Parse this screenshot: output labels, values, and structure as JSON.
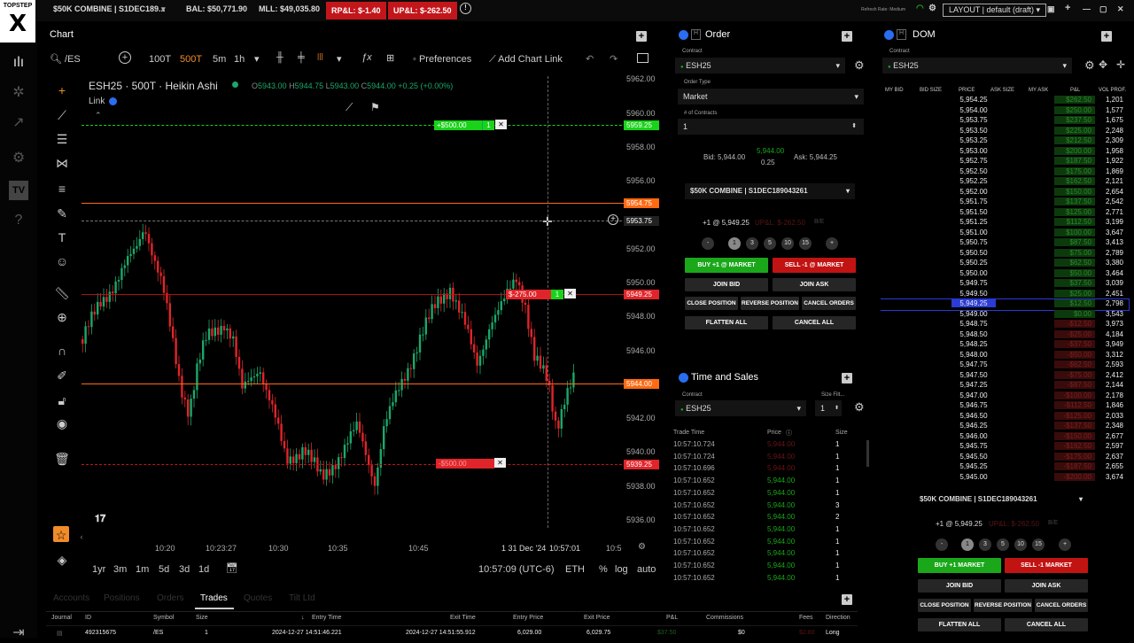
{
  "topbar": {
    "account": "$50K COMBINE  |  S1DEC189...",
    "bal": "BAL: $50,771.90",
    "mll": "MLL: $49,035.80",
    "rpnl": "RP&L: $-1.40",
    "upnl": "UP&L: $-262.50",
    "refresh": "Refresh Rate: Medium",
    "layout": "LAYOUT | default (draft)"
  },
  "logo": {
    "brand": "TOPSTEP",
    "mark": "X"
  },
  "chart": {
    "panel_title": "Chart",
    "symbol_search": "/ES",
    "intervals": [
      "100T",
      "500T",
      "5m",
      "1h"
    ],
    "active_interval": "500T",
    "preferences": "Preferences",
    "add_chart_link": "Add Chart Link",
    "legend_title": "ESH25 · 500T · Heikin Ashi",
    "ohlc": {
      "o": "5943.00",
      "h": "5944.75",
      "l": "5943.00",
      "c": "5944.00",
      "chg": "+0.25 (+0.00%)"
    },
    "link_label": "Link",
    "y_ticks": [
      "5962.00",
      "5960.00",
      "5958.00",
      "5956.00",
      "5952.00",
      "5950.00",
      "5948.00",
      "5946.00",
      "5942.00",
      "5940.00",
      "5938.00",
      "5936.00"
    ],
    "x_ticks": [
      "10:20",
      "10:23:27",
      "10:30",
      "10:35",
      "10:45",
      "31 Dec '24",
      "10:57:01",
      "10:5"
    ],
    "price_tags": {
      "tp": "5959.25",
      "tp_pnl": "+$500.00",
      "tp_qty": "1",
      "orange_top": "5954.75",
      "crosshair": "5953.75",
      "position": "5949.25",
      "position_pnl": "$-275.00",
      "position_qty": "1",
      "last": "5944.00",
      "sl": "5939.25",
      "sl_pnl": "-$500.00"
    },
    "ranges": [
      "1yr",
      "3m",
      "1m",
      "5d",
      "3d",
      "1d"
    ],
    "clock": "10:57:09 (UTC-6)",
    "session": "ETH",
    "scale_opts": [
      "%",
      "log",
      "auto"
    ],
    "colors": {
      "up": "#1aa86a",
      "down": "#e0242a",
      "orange": "#ff6a13",
      "tp_green": "#19d219"
    }
  },
  "order": {
    "title": "Order",
    "contract_label": "Contract",
    "contract": "ESH25",
    "order_type_label": "Order Type",
    "order_type": "Market",
    "contracts_label": "# of Contracts",
    "contracts": "1",
    "bid": "Bid: 5,944.00",
    "ask": "Ask: 5,944.25",
    "last": "5,944.00",
    "spread": "0.25",
    "account": "$50K COMBINE  |  S1DEC189043261",
    "position": "+1 @ 5,949.25",
    "position_pnl": "UP&L: $-262.50",
    "be": "B/E",
    "qtys": [
      "-",
      "1",
      "3",
      "5",
      "10",
      "15",
      "+"
    ],
    "buy": "BUY +1 @ MARKET",
    "sell": "SELL -1 @ MARKET",
    "join_bid": "JOIN BID",
    "join_ask": "JOIN ASK",
    "close_position": "CLOSE POSITION",
    "reverse_position": "REVERSE POSITION",
    "cancel_orders": "CANCEL ORDERS",
    "flatten_all": "FLATTEN ALL",
    "cancel_all": "CANCEL ALL"
  },
  "time_sales": {
    "title": "Time and Sales",
    "contract_label": "Contract",
    "contract": "ESH25",
    "size_filter_label": "Size Filt...",
    "size_filter": "1",
    "headers": [
      "Trade Time",
      "Price",
      "Size"
    ],
    "rows": [
      {
        "t": "10:57:10.724",
        "p": "5,944.00",
        "s": "1",
        "side": "sell"
      },
      {
        "t": "10:57:10.724",
        "p": "5,944.00",
        "s": "1",
        "side": "sell"
      },
      {
        "t": "10:57:10.696",
        "p": "5,944.00",
        "s": "1",
        "side": "sell"
      },
      {
        "t": "10:57:10.652",
        "p": "5,944.00",
        "s": "1",
        "side": "buy"
      },
      {
        "t": "10:57:10.652",
        "p": "5,944.00",
        "s": "1",
        "side": "buy"
      },
      {
        "t": "10:57:10.652",
        "p": "5,944.00",
        "s": "3",
        "side": "buy"
      },
      {
        "t": "10:57:10.652",
        "p": "5,944.00",
        "s": "2",
        "side": "buy"
      },
      {
        "t": "10:57:10.652",
        "p": "5,944.00",
        "s": "1",
        "side": "buy"
      },
      {
        "t": "10:57:10.652",
        "p": "5,944.00",
        "s": "1",
        "side": "buy"
      },
      {
        "t": "10:57:10.652",
        "p": "5,944.00",
        "s": "1",
        "side": "buy"
      },
      {
        "t": "10:57:10.652",
        "p": "5,944.00",
        "s": "1",
        "side": "buy"
      },
      {
        "t": "10:57:10.652",
        "p": "5,944.00",
        "s": "1",
        "side": "buy"
      }
    ]
  },
  "dom": {
    "title": "DOM",
    "contract_label": "Contract",
    "contract": "ESH25",
    "headers": [
      "MY BID",
      "BID SIZE",
      "PRICE",
      "ASK SIZE",
      "MY ASK",
      "P&L",
      "VOL PROF."
    ],
    "rows": [
      {
        "p": "5,954.25",
        "pnl": "$262.50",
        "v": "1,201"
      },
      {
        "p": "5,954.00",
        "pnl": "$250.00",
        "v": "1,577"
      },
      {
        "p": "5,953.75",
        "pnl": "$237.50",
        "v": "1,675"
      },
      {
        "p": "5,953.50",
        "pnl": "$225.00",
        "v": "2,248"
      },
      {
        "p": "5,953.25",
        "pnl": "$212.50",
        "v": "2,309"
      },
      {
        "p": "5,953.00",
        "pnl": "$200.00",
        "v": "1,958"
      },
      {
        "p": "5,952.75",
        "pnl": "$187.50",
        "v": "1,922"
      },
      {
        "p": "5,952.50",
        "pnl": "$175.00",
        "v": "1,869"
      },
      {
        "p": "5,952.25",
        "pnl": "$162.50",
        "v": "2,121"
      },
      {
        "p": "5,952.00",
        "pnl": "$150.00",
        "v": "2,654"
      },
      {
        "p": "5,951.75",
        "pnl": "$137.50",
        "v": "2,542"
      },
      {
        "p": "5,951.50",
        "pnl": "$125.00",
        "v": "2,771"
      },
      {
        "p": "5,951.25",
        "pnl": "$112.50",
        "v": "3,199"
      },
      {
        "p": "5,951.00",
        "pnl": "$100.00",
        "v": "3,647"
      },
      {
        "p": "5,950.75",
        "pnl": "$87.50",
        "v": "3,413"
      },
      {
        "p": "5,950.50",
        "pnl": "$75.00",
        "v": "2,789"
      },
      {
        "p": "5,950.25",
        "pnl": "$62.50",
        "v": "3,380"
      },
      {
        "p": "5,950.00",
        "pnl": "$50.00",
        "v": "3,464"
      },
      {
        "p": "5,949.75",
        "pnl": "$37.50",
        "v": "3,039"
      },
      {
        "p": "5,949.50",
        "pnl": "$25.00",
        "v": "2,451"
      },
      {
        "p": "5,949.25",
        "pnl": "$12.50",
        "v": "2,798",
        "current": true
      },
      {
        "p": "5,949.00",
        "pnl": "$0.00",
        "v": "3,543"
      },
      {
        "p": "5,948.75",
        "pnl": "-$12.50",
        "v": "3,973"
      },
      {
        "p": "5,948.50",
        "pnl": "-$25.00",
        "v": "4,184"
      },
      {
        "p": "5,948.25",
        "pnl": "-$37.50",
        "v": "3,949"
      },
      {
        "p": "5,948.00",
        "pnl": "-$50.00",
        "v": "3,312"
      },
      {
        "p": "5,947.75",
        "pnl": "-$62.50",
        "v": "2,593"
      },
      {
        "p": "5,947.50",
        "pnl": "-$75.00",
        "v": "2,412"
      },
      {
        "p": "5,947.25",
        "pnl": "-$87.50",
        "v": "2,144"
      },
      {
        "p": "5,947.00",
        "pnl": "-$100.00",
        "v": "2,178"
      },
      {
        "p": "5,946.75",
        "pnl": "-$112.50",
        "v": "1,846"
      },
      {
        "p": "5,946.50",
        "pnl": "-$125.00",
        "v": "2,033"
      },
      {
        "p": "5,946.25",
        "pnl": "-$137.50",
        "v": "2,348"
      },
      {
        "p": "5,946.00",
        "pnl": "-$150.00",
        "v": "2,677"
      },
      {
        "p": "5,945.75",
        "pnl": "-$162.50",
        "v": "2,597"
      },
      {
        "p": "5,945.50",
        "pnl": "-$175.00",
        "v": "2,637"
      },
      {
        "p": "5,945.25",
        "pnl": "-$187.50",
        "v": "2,655"
      },
      {
        "p": "5,945.00",
        "pnl": "-$200.00",
        "v": "3,674"
      }
    ],
    "account": "$50K COMBINE  |  S1DEC189043261",
    "position": "+1 @ 5,949.25",
    "position_pnl": "UP&L: $-262.50",
    "be": "B/E",
    "qtys": [
      "-",
      "1",
      "3",
      "5",
      "10",
      "15",
      "+"
    ],
    "buy": "BUY +1 MARKET",
    "sell": "SELL -1 MARKET",
    "join_bid": "JOIN BID",
    "join_ask": "JOIN ASK",
    "close_position": "CLOSE POSITION",
    "reverse_position": "REVERSE POSITION",
    "cancel_orders": "CANCEL ORDERS",
    "flatten_all": "FLATTEN ALL",
    "cancel_all": "CANCEL ALL"
  },
  "bottom": {
    "tabs": [
      "Accounts",
      "Positions",
      "Orders",
      "Trades",
      "Quotes",
      "Tilt Ltd"
    ],
    "active_tab": "Trades",
    "headers": [
      "Journal",
      "ID",
      "Symbol",
      "Size",
      "Entry Time",
      "Exit Time",
      "Entry Price",
      "Exit Price",
      "P&L",
      "Commissions",
      "Fees",
      "Direction"
    ],
    "row": {
      "id": "492315675",
      "symbol": "/ES",
      "size": "1",
      "entry_time": "2024-12-27 14:51:46.221",
      "exit_time": "2024-12-27 14:51:55.912",
      "entry_price": "6,029.00",
      "exit_price": "6,029.75",
      "pnl": "$37.50",
      "commissions": "$0",
      "fees": "$2.80",
      "direction": "Long"
    }
  }
}
